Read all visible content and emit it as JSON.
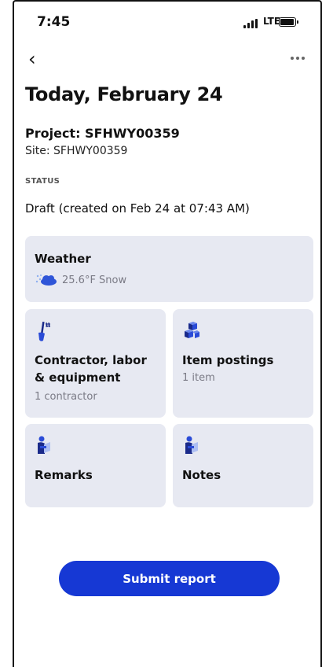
{
  "status_bar": {
    "time": "7:45",
    "network": "LTE"
  },
  "nav": {
    "back_glyph": "‹",
    "more_icon": "more-horizontal-icon"
  },
  "header": {
    "title": "Today, February 24",
    "project": "Project: SFHWY00359",
    "site": "Site: SFHWY00359"
  },
  "status": {
    "label": "STATUS",
    "text": "Draft (created on Feb 24 at 07:43 AM)"
  },
  "cards": {
    "weather": {
      "title": "Weather",
      "summary": "25.6°F Snow",
      "icon": "snow-cloud-icon"
    },
    "contractor": {
      "title": "Contractor, labor & equipment",
      "subtitle": "1 contractor",
      "icon": "shovel-icon"
    },
    "items": {
      "title": "Item postings",
      "subtitle": "1 item",
      "icon": "boxes-icon"
    },
    "remarks": {
      "title": "Remarks",
      "icon": "person-reading-icon"
    },
    "notes": {
      "title": "Notes",
      "icon": "person-reading-icon"
    }
  },
  "actions": {
    "submit_label": "Submit report"
  },
  "colors": {
    "accent": "#1638d4",
    "card_bg": "#e7e9f2",
    "icon_blue": "#2a4bd7"
  }
}
